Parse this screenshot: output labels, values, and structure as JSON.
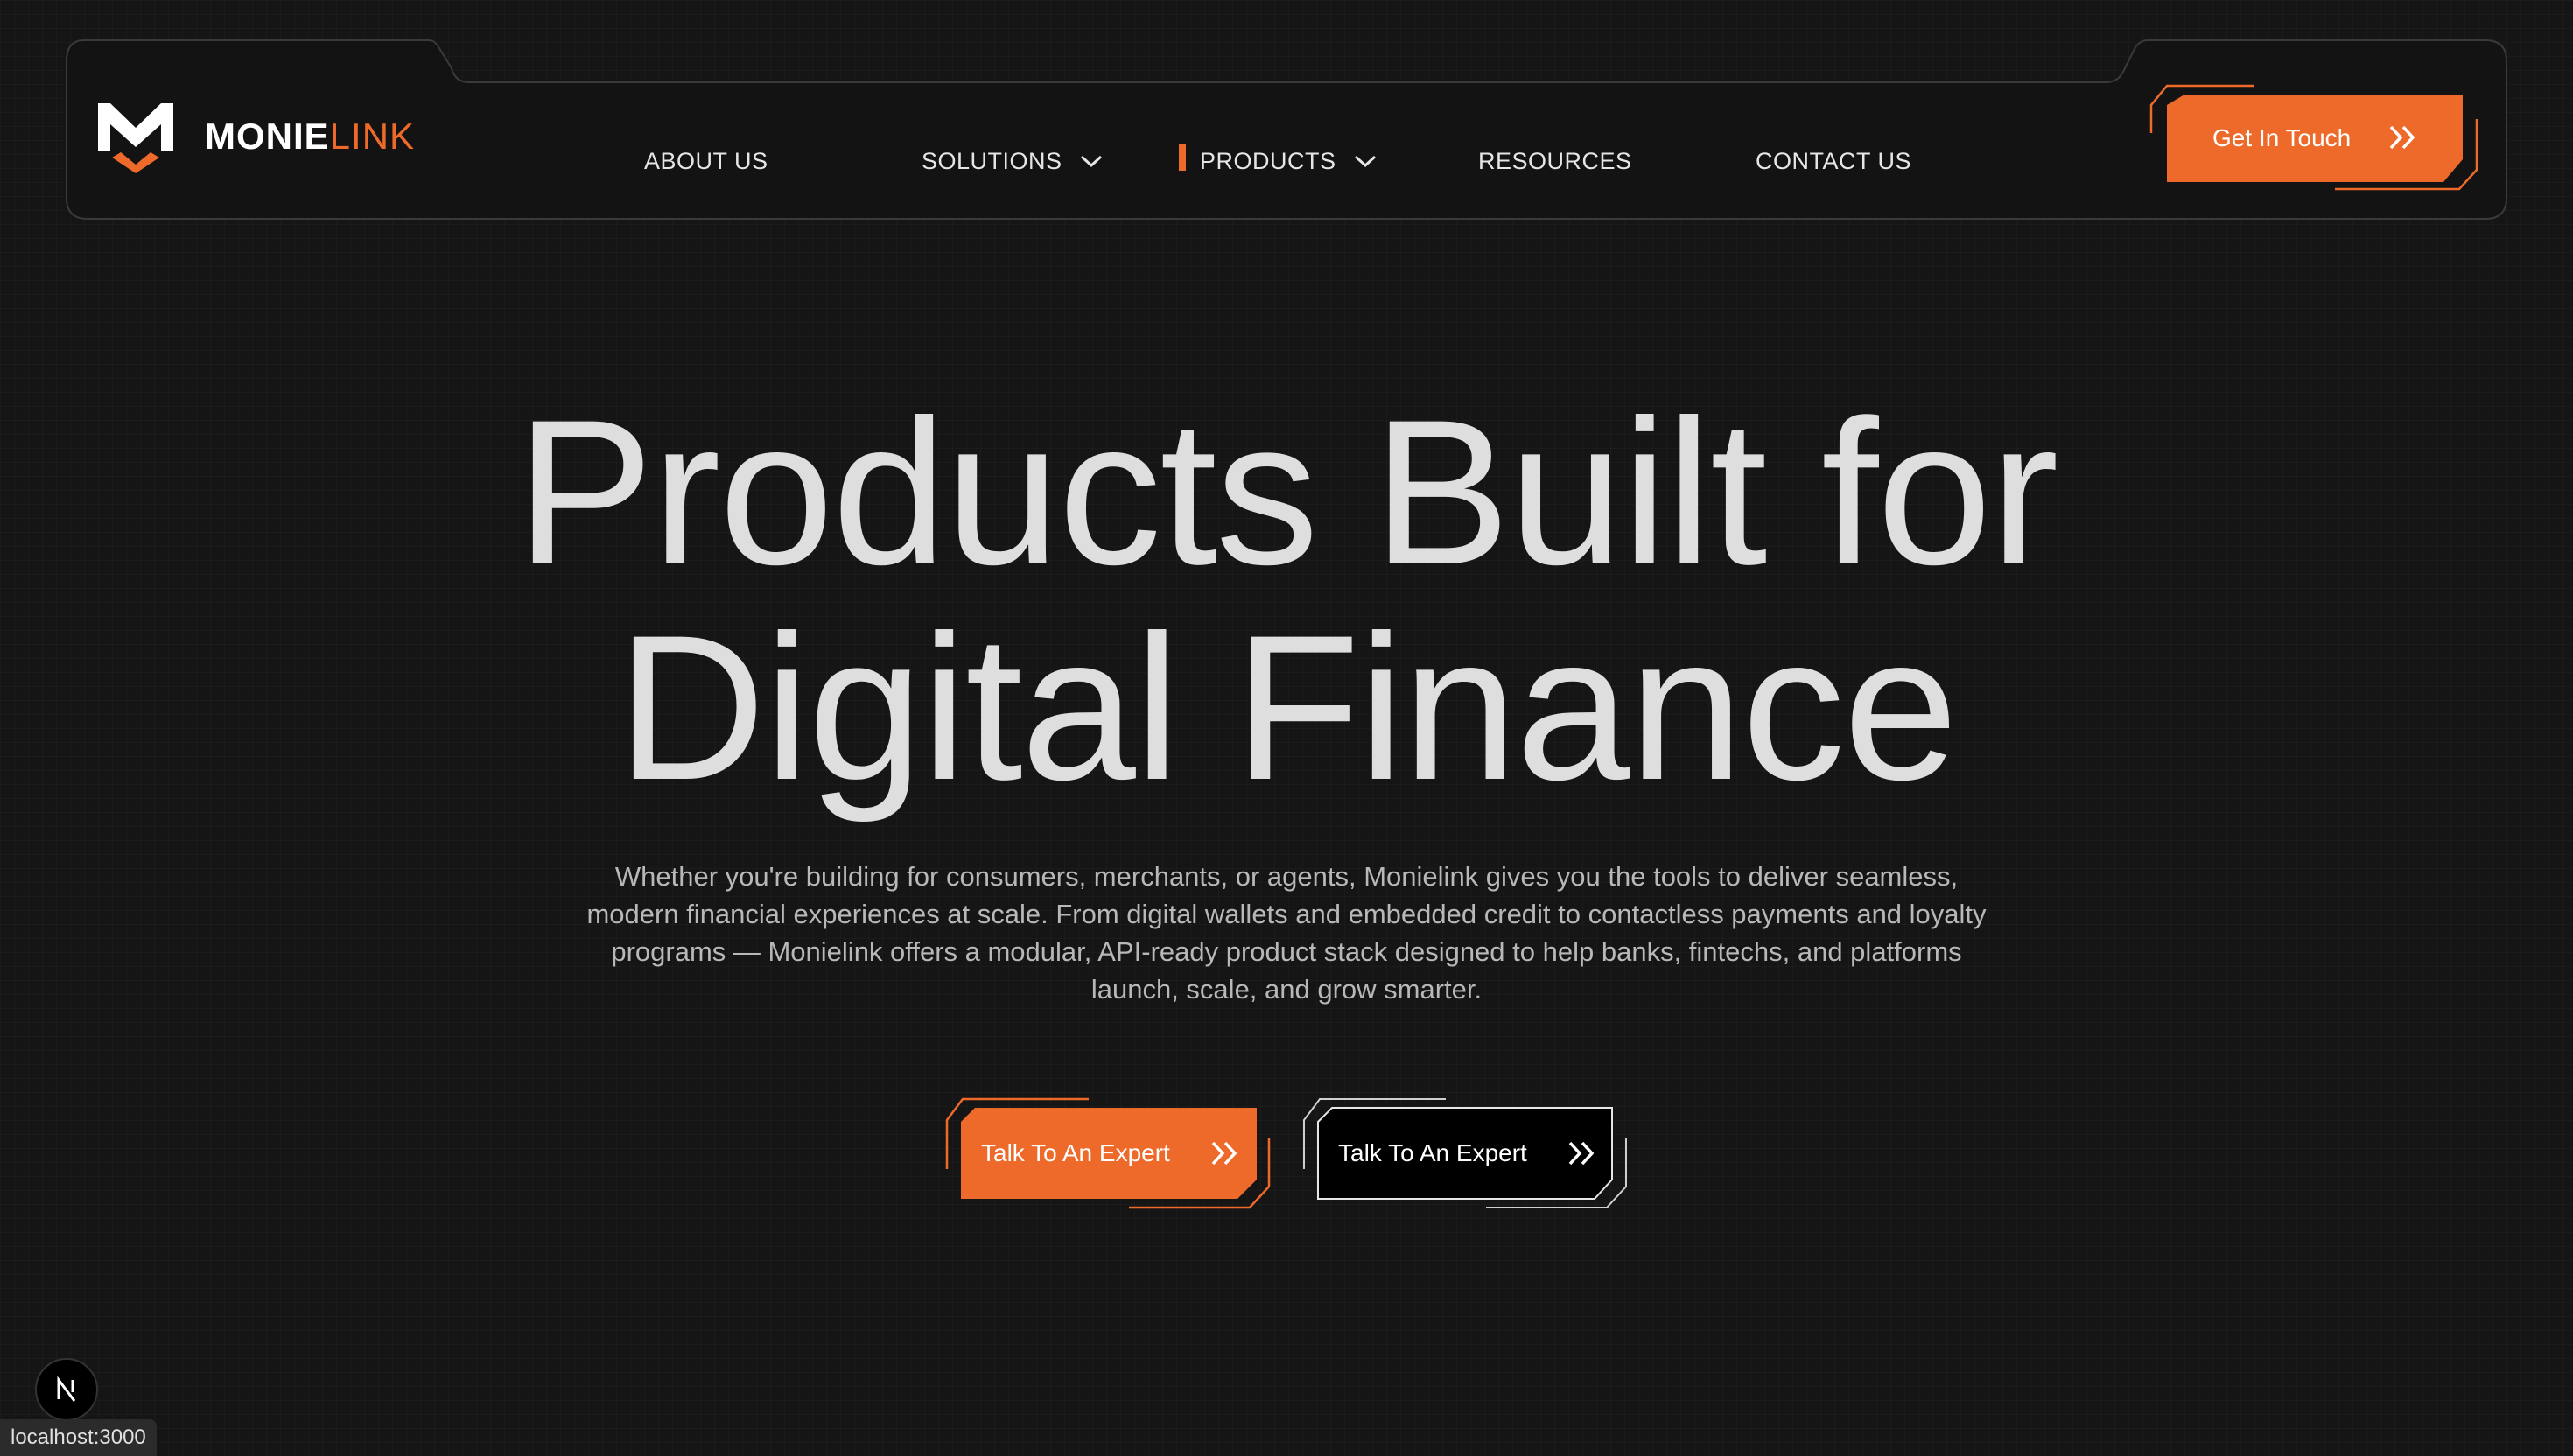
{
  "brand": {
    "name_primary": "MONIE",
    "name_accent": "LINK",
    "accent_color": "#ee6a2a"
  },
  "nav": {
    "items": [
      {
        "label": "ABOUT US",
        "has_dropdown": false,
        "active": false
      },
      {
        "label": "SOLUTIONS",
        "has_dropdown": true,
        "active": false
      },
      {
        "label": "PRODUCTS",
        "has_dropdown": true,
        "active": true
      },
      {
        "label": "RESOURCES",
        "has_dropdown": false,
        "active": false
      },
      {
        "label": "CONTACT US",
        "has_dropdown": false,
        "active": false
      }
    ],
    "cta_label": "Get In Touch"
  },
  "hero": {
    "title_line1": "Products Built for",
    "title_line2": "Digital Finance",
    "description": "Whether you're building for consumers, merchants, or agents, Monielink gives you the tools to deliver seamless, modern financial experiences at scale. From digital wallets and embedded credit to contactless payments and loyalty programs — Monielink offers a modular, API-ready product stack designed to help banks, fintechs, and platforms launch, scale, and grow smarter.",
    "primary_button": "Talk To An Expert",
    "secondary_button": "Talk To An Expert"
  },
  "overlay": {
    "next_badge": "N",
    "status_url": "localhost:3000"
  },
  "icons": {
    "logo": "monielink-logo-icon",
    "dropdown": "chevron-down-icon",
    "button_arrow": "double-chevron-right-icon"
  }
}
